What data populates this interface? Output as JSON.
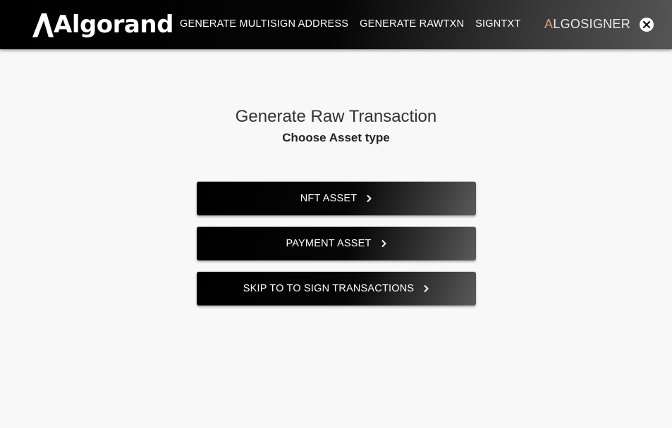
{
  "header": {
    "brand": "Algorand",
    "nav": [
      {
        "label": "GENERATE MULTISIGN ADDRESS"
      },
      {
        "label": "GENERATE RAWTXN"
      },
      {
        "label": "SIGNTXT"
      }
    ],
    "signer_logo_accent": "A",
    "signer_logo_rest": "LGOSIGNER",
    "close_icon": "close-icon"
  },
  "main": {
    "title": "Generate Raw Transaction",
    "subtitle": "Choose Asset type",
    "buttons": [
      {
        "label": "NFT ASSET",
        "icon": "chevron-right-icon"
      },
      {
        "label": "PAYMENT ASSET",
        "icon": "chevron-right-icon"
      },
      {
        "label": "SKIP TO TO SIGN TRANSACTIONS",
        "icon": "chevron-right-icon"
      }
    ]
  },
  "colors": {
    "navbar_start": "#000000",
    "navbar_end": "#555555",
    "page_background": "#f8f8f8",
    "button_start": "#000000",
    "button_end": "#5a5a5a",
    "text_on_dark": "#ffffff"
  }
}
